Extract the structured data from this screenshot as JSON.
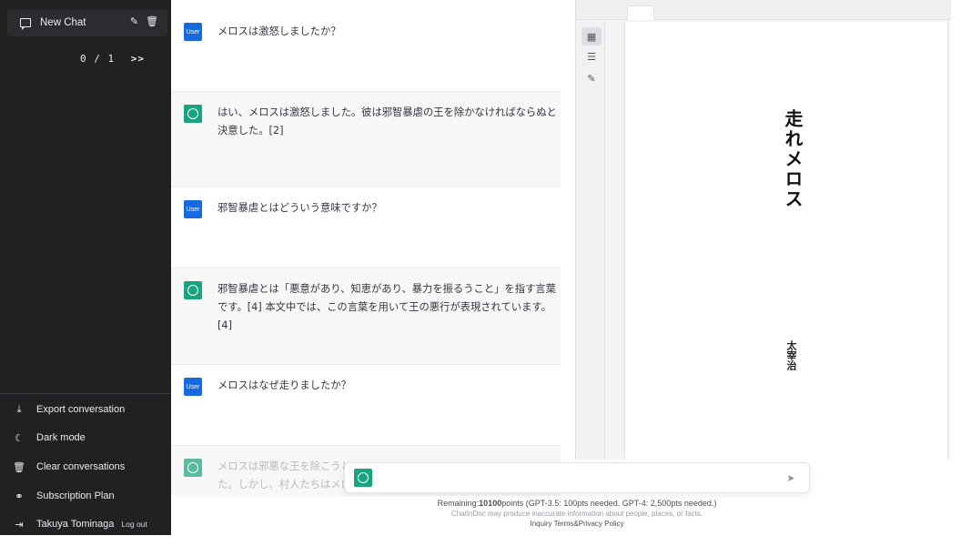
{
  "sidebar": {
    "new_chat": "New Chat",
    "pager": {
      "current": "0 / 1",
      "next": ">>"
    },
    "items": [
      {
        "icon": "⤓",
        "label": "Export conversation"
      },
      {
        "icon": "☾",
        "label": "Dark mode"
      },
      {
        "icon": "🗑",
        "label": "Clear conversations"
      },
      {
        "icon": "⚭",
        "label": "Subscription Plan"
      }
    ],
    "user": {
      "name": "Takuya Tominaga",
      "logout": "Log out"
    }
  },
  "messages": [
    {
      "role": "user",
      "avatar": "User",
      "text": "メロスは激怒しましたか？"
    },
    {
      "role": "bot",
      "text": "はい、メロスは激怒しました。彼は邪智暴虐の王を除かなければならぬと決意した。[2]"
    },
    {
      "role": "user",
      "avatar": "User",
      "text": "邪智暴虐とはどういう意味ですか？"
    },
    {
      "role": "bot",
      "text": "邪智暴虐とは「悪意があり、知恵があり、暴力を振るうこと」を指す言葉です。[4] 本文中では、この言葉を用いて王の悪行が表現されています。[4]"
    },
    {
      "role": "user",
      "avatar": "User",
      "text": "メロスはなぜ走りましたか？"
    },
    {
      "role": "bot",
      "text_line1": "メロスは邪悪な王を除こうと",
      "text_line2": "た。しかし、村人たちはメロ"
    }
  ],
  "composer": {
    "placeholder": ""
  },
  "footer": {
    "remaining_prefix": "Remaining:",
    "remaining_points": "10100",
    "remaining_suffix": "points (GPT-3.5: 100pts needed. GPT-4: 2,500pts needed.)",
    "disclaimer": "ChatInDoc may produce inaccurate information about people, places, or facts.",
    "link_inquiry": "Inquiry",
    "link_terms": "Terms&Privacy Policy"
  },
  "document": {
    "title": "走れメロス",
    "author": "太宰治"
  },
  "colors": {
    "sidebar_bg": "#202123",
    "user_avatar": "#1769e0",
    "bot_avatar": "#19a37f"
  }
}
